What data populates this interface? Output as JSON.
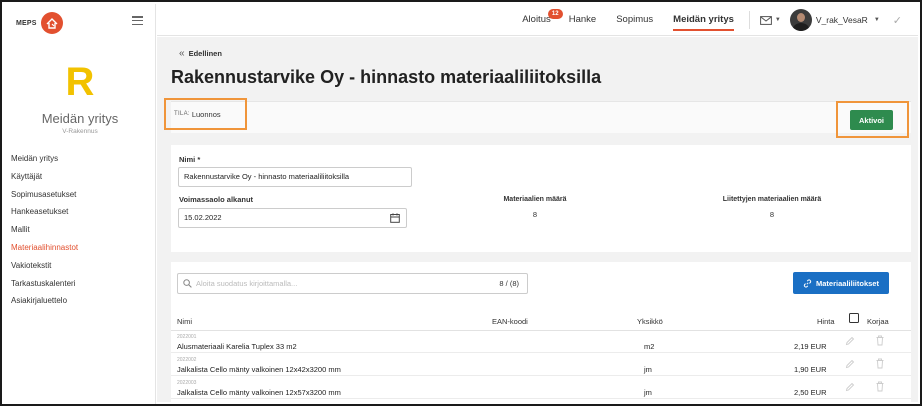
{
  "sidebar": {
    "brand": "MEPS",
    "initial": "R",
    "company_name": "Meidän yritys",
    "company_sub": "V-Rakennus",
    "items": [
      {
        "label": "Meidän yritys"
      },
      {
        "label": "Käyttäjät"
      },
      {
        "label": "Sopimusasetukset"
      },
      {
        "label": "Hankeasetukset"
      },
      {
        "label": "Mallit"
      },
      {
        "label": "Materiaalihinnastot",
        "active": true
      },
      {
        "label": "Vakiotekstit"
      },
      {
        "label": "Tarkastuskalenteri"
      },
      {
        "label": "Asiakirjaluettelo"
      }
    ]
  },
  "topbar": {
    "nav": [
      {
        "label": "Aloitus",
        "badge": "12"
      },
      {
        "label": "Hanke"
      },
      {
        "label": "Sopimus"
      },
      {
        "label": "Meidän yritys",
        "active": true
      }
    ],
    "user_name": "V_rak_VesaR"
  },
  "page": {
    "back_label": "Edellinen",
    "title": "Rakennustarvike Oy - hinnasto materiaaliliitoksilla",
    "status_key": "TILA:",
    "status_value": "Luonnos",
    "activate_label": "Aktivoi"
  },
  "form": {
    "name_label": "Nimi *",
    "name_value": "Rakennustarvike Oy - hinnasto materiaaliliitoksilla",
    "valid_label": "Voimassaolo alkanut",
    "valid_value": "15.02.2022",
    "materials_count_label": "Materiaalien määrä",
    "materials_count_value": "8",
    "linked_count_label": "Liitettyjen materiaalien määrä",
    "linked_count_value": "8"
  },
  "table": {
    "search_placeholder": "Aloita suodatus kirjoittamalla...",
    "count": "8 / (8)",
    "materials_button": "Materiaaliliitokset",
    "headers": {
      "name": "Nimi",
      "ean": "EAN-koodi",
      "unit": "Yksikkö",
      "price": "Hinta",
      "fix": "Korjaa"
    },
    "rows": [
      {
        "code": "2022001",
        "name": "Alusmateriaali Karelia Tuplex 33 m2",
        "unit": "m2",
        "price": "2,19 EUR"
      },
      {
        "code": "2022002",
        "name": "Jalkalista Cello mänty valkoinen 12x42x3200 mm",
        "unit": "jm",
        "price": "1,90 EUR"
      },
      {
        "code": "2022003",
        "name": "Jalkalista Cello mänty valkoinen 12x57x3200 mm",
        "unit": "jm",
        "price": "2,50 EUR"
      }
    ]
  },
  "colors": {
    "accent": "#e2502f",
    "success": "#2e8b4e",
    "primary": "#1a6fc4",
    "highlight": "#f0953a",
    "logo_letter": "#f2c200"
  }
}
